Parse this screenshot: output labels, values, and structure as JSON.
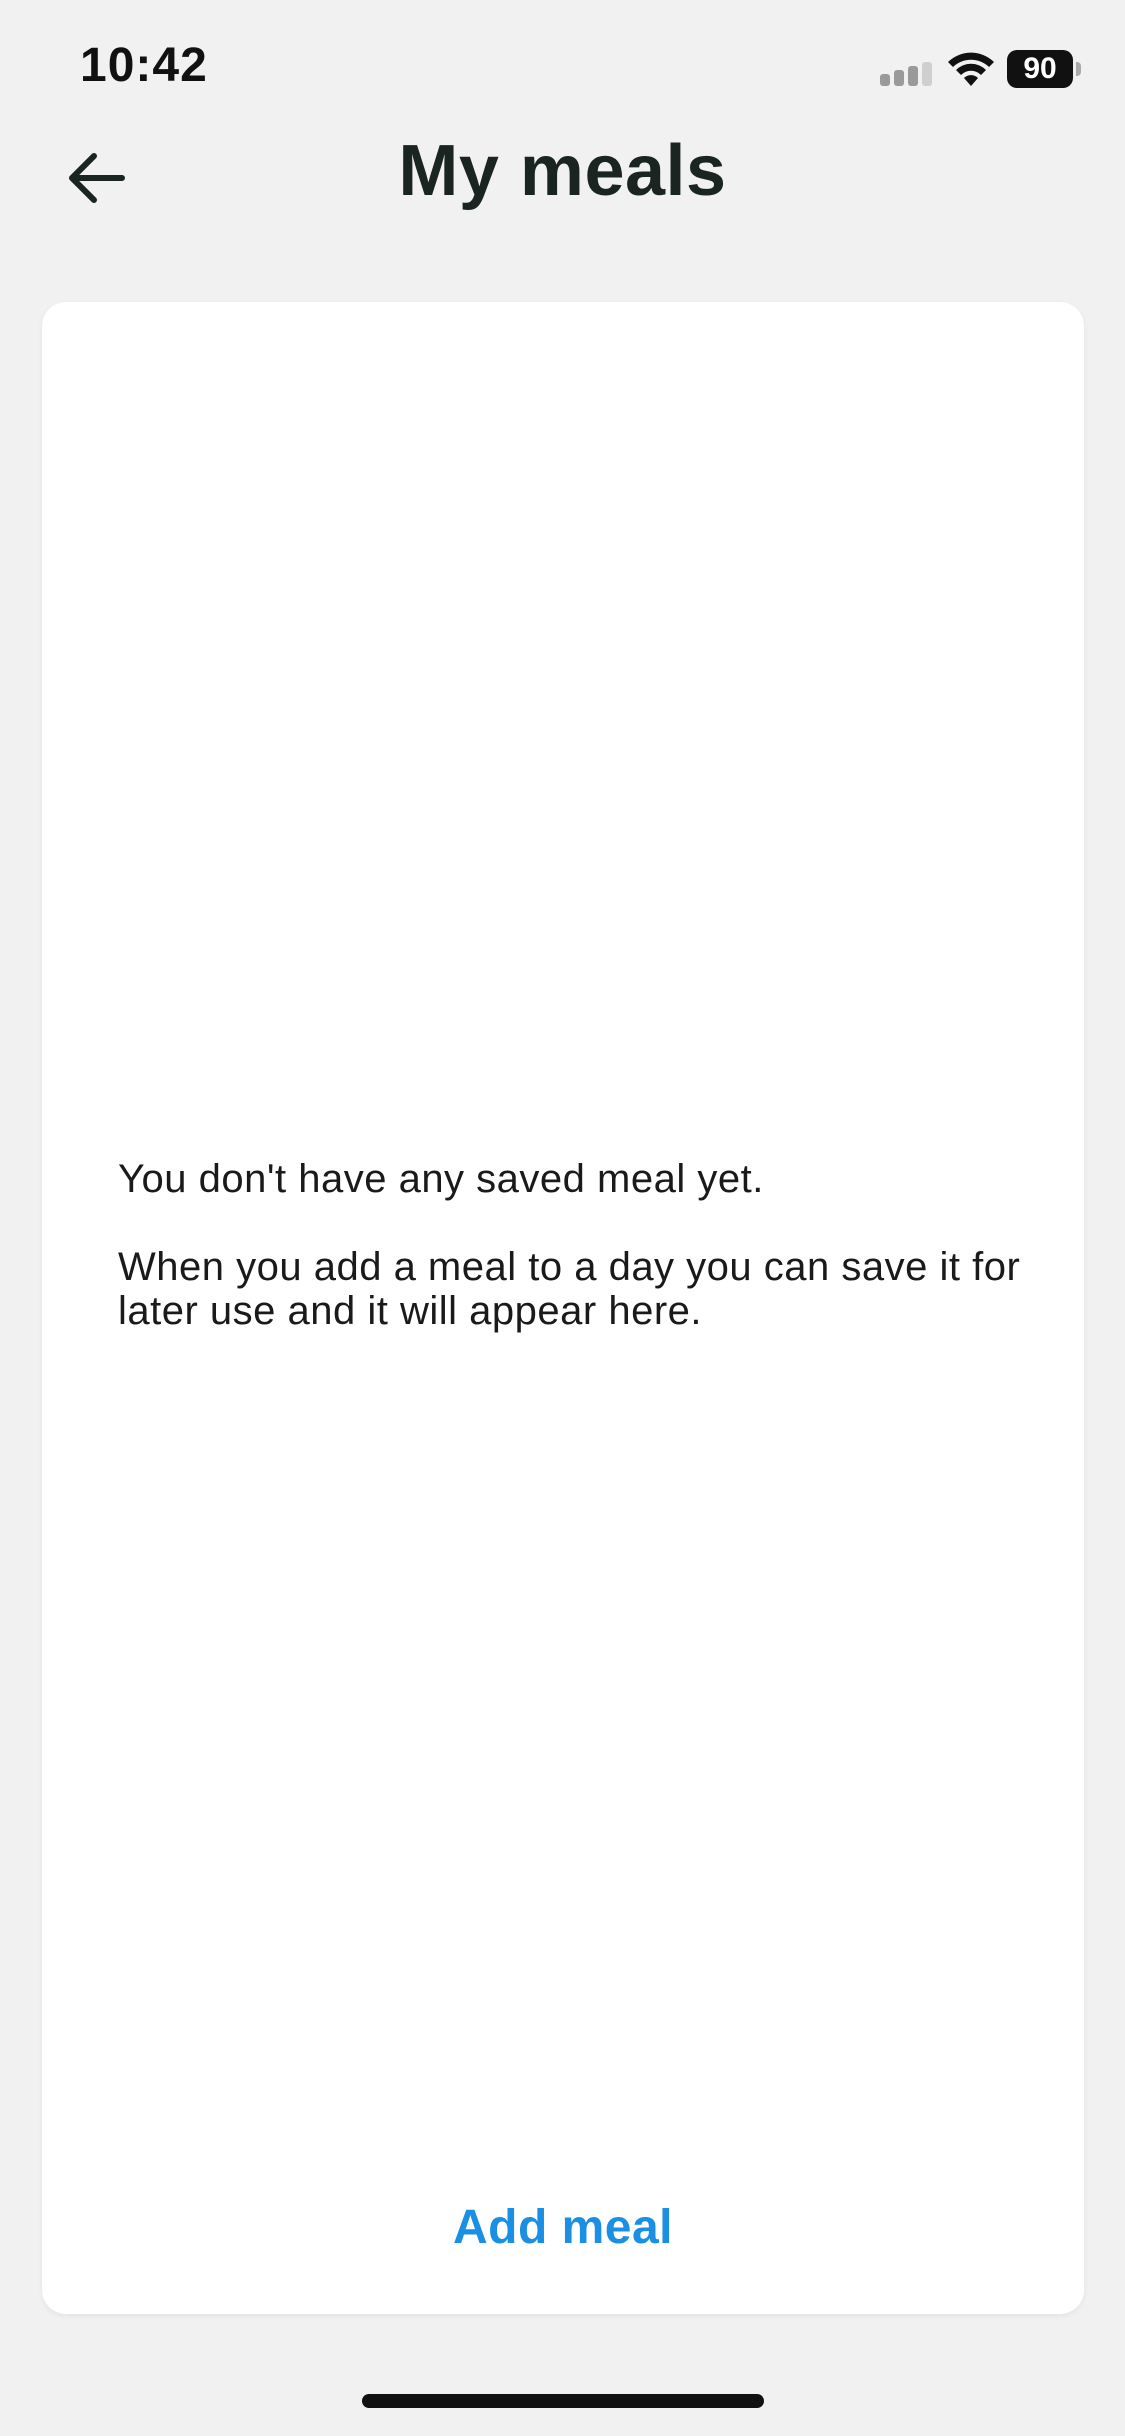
{
  "status_bar": {
    "time": "10:42",
    "battery_level": "90"
  },
  "header": {
    "title": "My meals",
    "back_icon": "arrow-left-icon"
  },
  "empty_state": {
    "line_1": "You don't have any saved meal yet.",
    "line_2": "When you add a meal to a day you can save it for later use and it will appear here."
  },
  "actions": {
    "add_meal_label": "Add meal"
  },
  "colors": {
    "background": "#f1f1f1",
    "card": "#ffffff",
    "accent": "#1a8fe3",
    "title": "#1a2420"
  }
}
